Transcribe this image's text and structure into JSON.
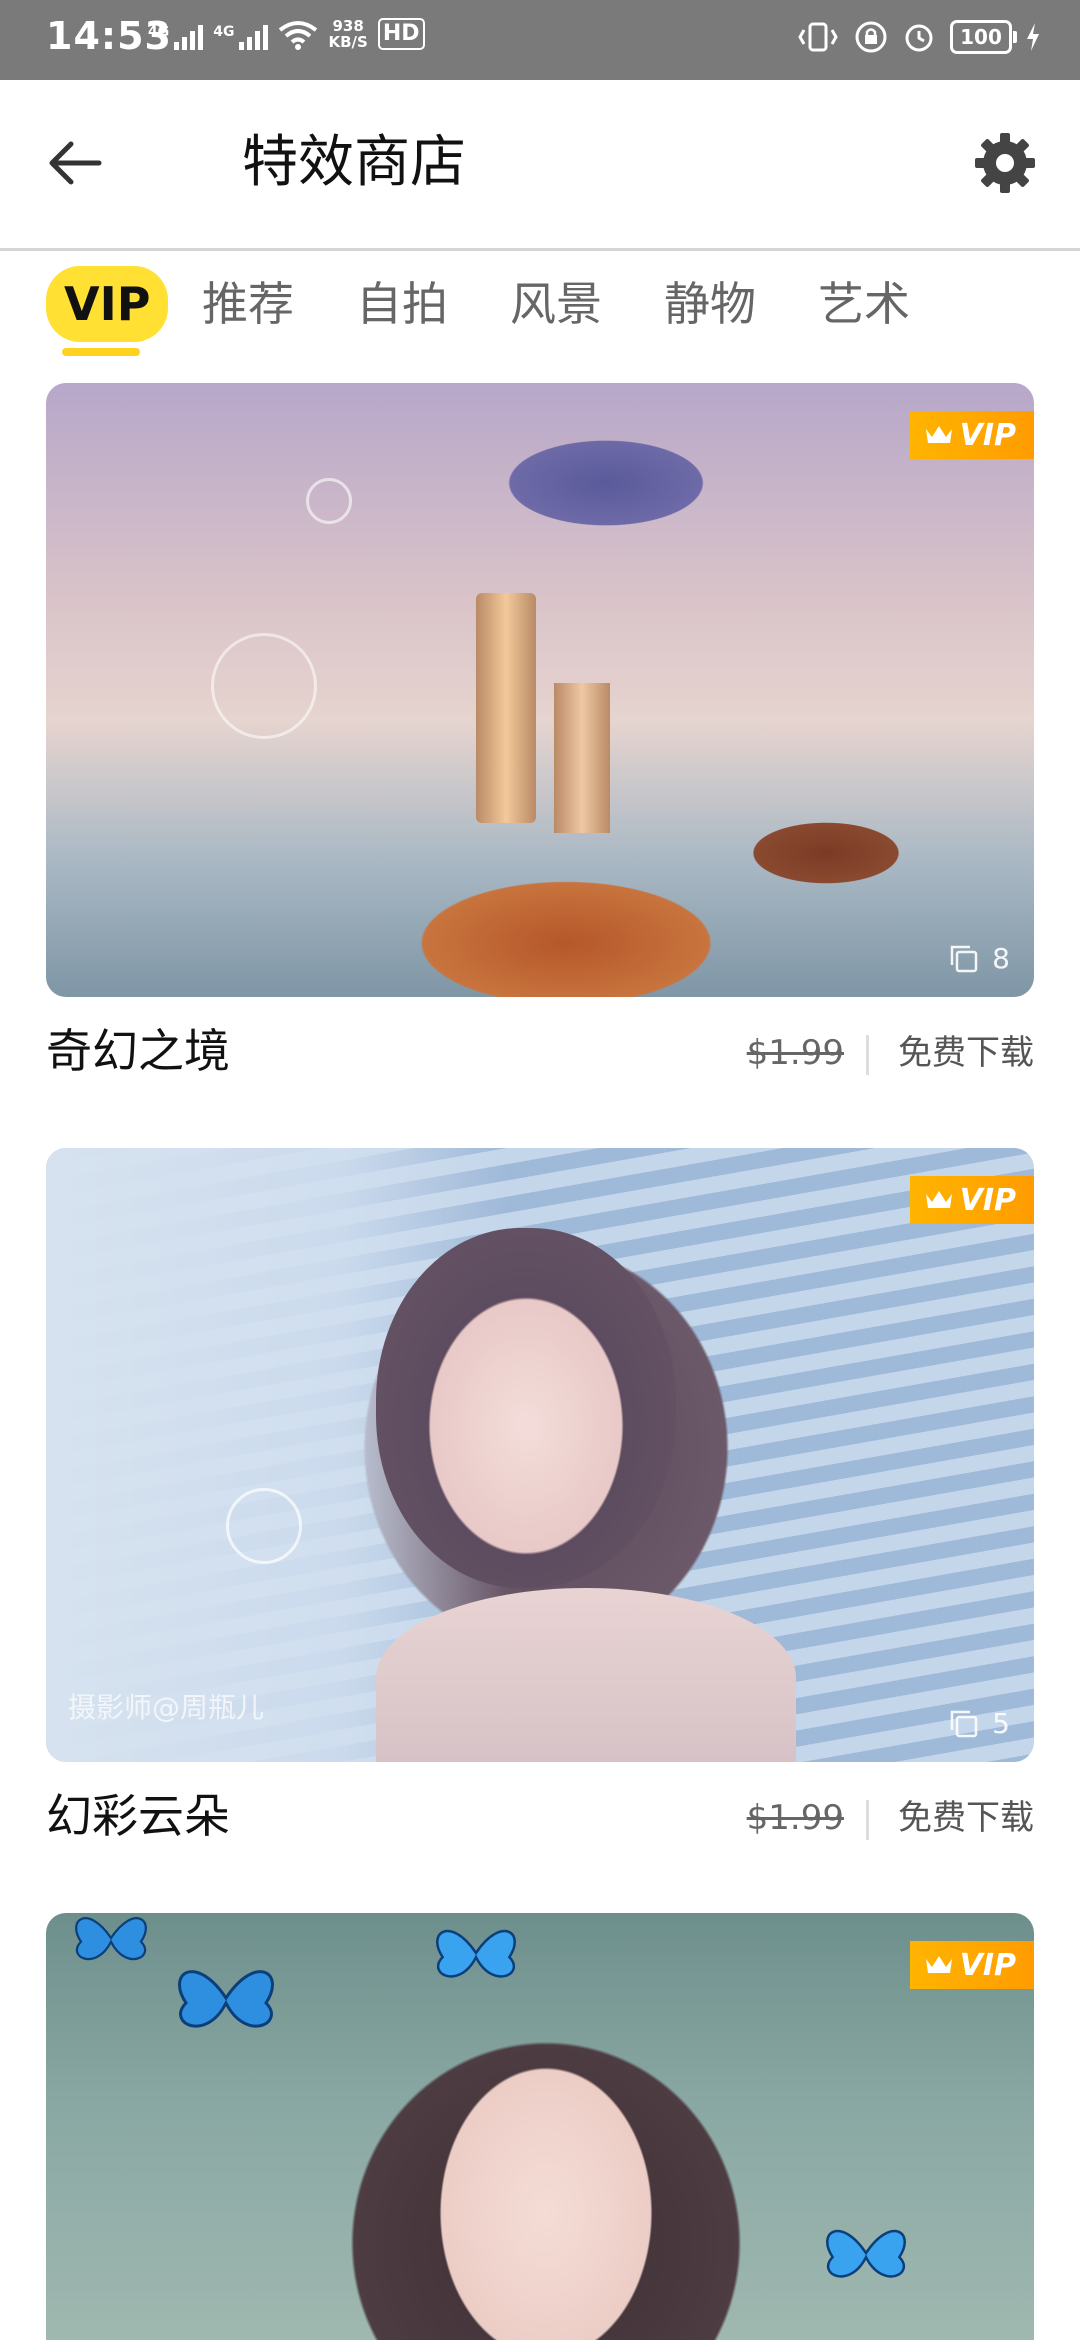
{
  "status_bar": {
    "time": "14:53",
    "network_speed_value": "938",
    "network_speed_unit": "KB/S",
    "hd_label": "HD",
    "battery": "100",
    "signal_labels": [
      "4G",
      "4G"
    ]
  },
  "header": {
    "title": "特效商店",
    "back_icon": "arrow-left-icon",
    "settings_icon": "gear-icon"
  },
  "tabs": [
    {
      "label": "VIP",
      "active": true
    },
    {
      "label": "推荐",
      "active": false
    },
    {
      "label": "自拍",
      "active": false
    },
    {
      "label": "风景",
      "active": false
    },
    {
      "label": "静物",
      "active": false
    },
    {
      "label": "艺术",
      "active": false
    }
  ],
  "cards": [
    {
      "name": "奇幻之境",
      "price": "$1.99",
      "action": "免费下载",
      "badge": "VIP",
      "count": "8",
      "credit": ""
    },
    {
      "name": "幻彩云朵",
      "price": "$1.99",
      "action": "免费下载",
      "badge": "VIP",
      "count": "5",
      "credit": "摄影师@周瓶儿"
    },
    {
      "name": "",
      "price": "",
      "action": "",
      "badge": "VIP",
      "count": "",
      "credit": ""
    }
  ],
  "colors": {
    "accent_yellow": "#ffe033",
    "vip_orange": "#ffa800",
    "status_bar": "#7a7a7a"
  }
}
